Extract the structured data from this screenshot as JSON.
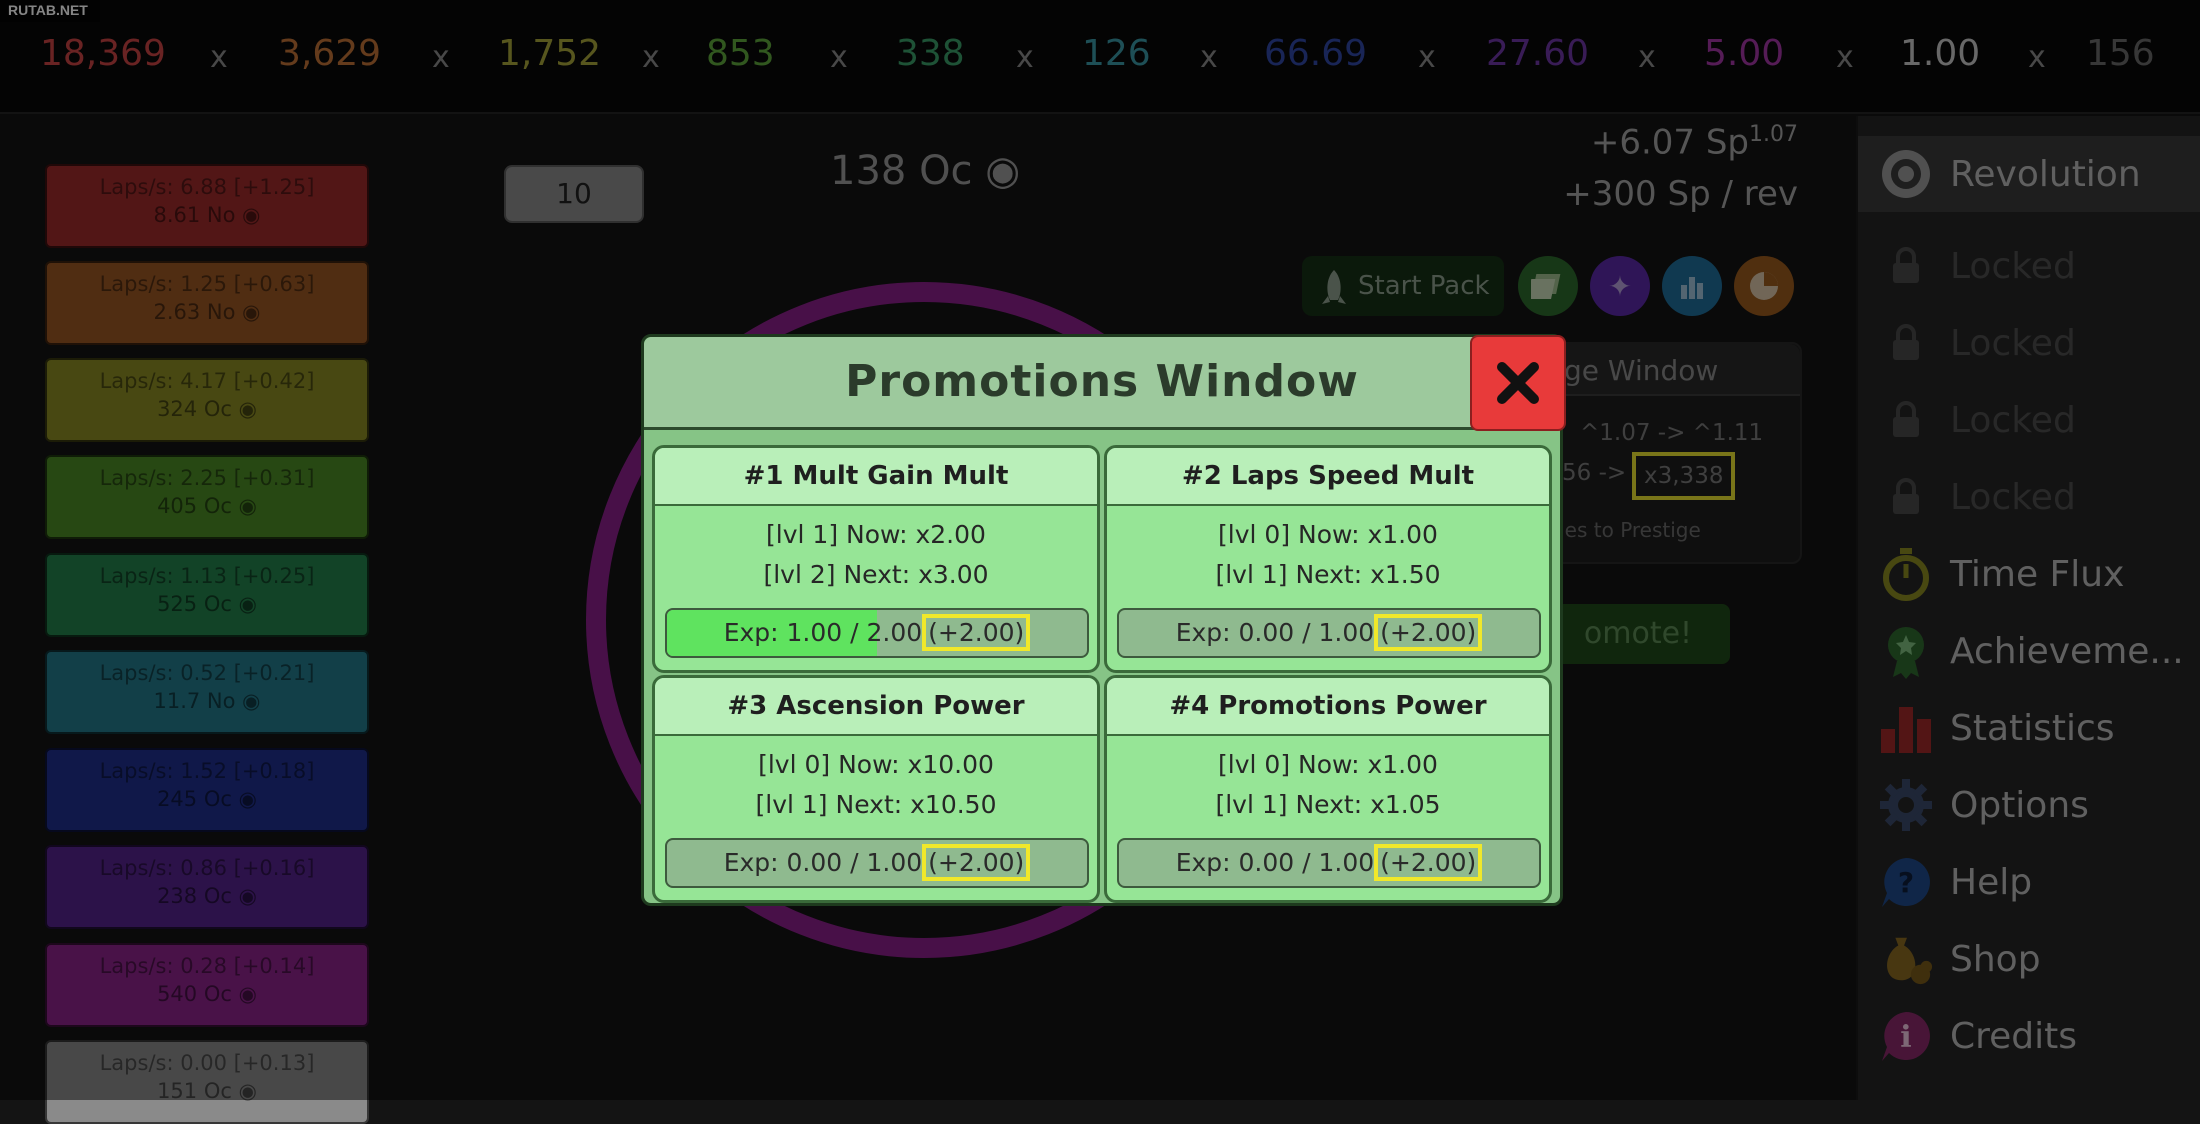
{
  "watermark": "RUTAB.NET",
  "multipliers": [
    {
      "value": "18,369",
      "color": "#c94343"
    },
    {
      "value": "3,629",
      "color": "#c07236"
    },
    {
      "value": "1,752",
      "color": "#a8a63a"
    },
    {
      "value": "853",
      "color": "#5ea83c"
    },
    {
      "value": "338",
      "color": "#3a9e68"
    },
    {
      "value": "126",
      "color": "#3a98a6"
    },
    {
      "value": "66.69",
      "color": "#3048a6"
    },
    {
      "value": "27.60",
      "color": "#6e36a6"
    },
    {
      "value": "5.00",
      "color": "#a336a6"
    },
    {
      "value": "1.00",
      "color": "#c7c7c7"
    },
    {
      "value": "156",
      "color": "#6a6a6a"
    }
  ],
  "multiplier_separator": "x",
  "rings": [
    {
      "line1": "Laps/s: 6.88 [+1.25]",
      "line2": "8.61 No",
      "color": "#9e2b2b"
    },
    {
      "line1": "Laps/s: 1.25 [+0.63]",
      "line2": "2.63 No",
      "color": "#9a5624"
    },
    {
      "line1": "Laps/s: 4.17 [+0.42]",
      "line2": "324 Oc",
      "color": "#8b8a24"
    },
    {
      "line1": "Laps/s: 2.25 [+0.31]",
      "line2": "405 Oc",
      "color": "#4c8a25"
    },
    {
      "line1": "Laps/s: 1.13 [+0.25]",
      "line2": "525 Oc",
      "color": "#23804b"
    },
    {
      "line1": "Laps/s: 0.52 [+0.21]",
      "line2": "11.7 No",
      "color": "#23798a"
    },
    {
      "line1": "Laps/s: 1.52 [+0.18]",
      "line2": "245 Oc",
      "color": "#1f2f8c"
    },
    {
      "line1": "Laps/s: 0.86 [+0.16]",
      "line2": "238 Oc",
      "color": "#55238c"
    },
    {
      "line1": "Laps/s: 0.28 [+0.14]",
      "line2": "540 Oc",
      "color": "#8c238a"
    },
    {
      "line1": "Laps/s: 0.00 [+0.13]",
      "line2": "151 Oc",
      "color": "#8a8a8a"
    }
  ],
  "quantity_input": "10",
  "orbit_count": "138 Oc",
  "sp_rate": "+6.07 Sp",
  "sp_exponent": "1.07",
  "sp_per_rev": "+300 Sp / rev",
  "buttons": {
    "start_pack": "Start Pack"
  },
  "prestige_card": {
    "title": "ge Window",
    "exp_line": "^1.07 -> ^1.11",
    "mult_prefix": "56 ->",
    "mult_value": "x3,338",
    "footer": "nes to Prestige"
  },
  "promote_label": "omote!",
  "sidebar": [
    {
      "label": "Revolution",
      "icon": "target-icon",
      "active": true
    },
    {
      "label": "Locked",
      "icon": "lock-icon"
    },
    {
      "label": "Locked",
      "icon": "lock-icon"
    },
    {
      "label": "Locked",
      "icon": "lock-icon"
    },
    {
      "label": "Locked",
      "icon": "lock-icon"
    },
    {
      "label": "Time Flux",
      "icon": "stopwatch-icon"
    },
    {
      "label": "Achieveme...",
      "icon": "medal-icon"
    },
    {
      "label": "Statistics",
      "icon": "bar-chart-icon"
    },
    {
      "label": "Options",
      "icon": "gear-icon"
    },
    {
      "label": "Help",
      "icon": "help-icon"
    },
    {
      "label": "Shop",
      "icon": "money-bag-icon"
    },
    {
      "label": "Credits",
      "icon": "info-icon"
    }
  ],
  "modal": {
    "title": "Promotions Window",
    "cards": [
      {
        "title": "#1 Mult Gain Mult",
        "now": "[lvl 1] Now: x2.00",
        "next": "[lvl 2] Next: x3.00",
        "exp": "Exp: 1.00 / 2.00",
        "gain": "(+2.00)",
        "progress": 0.5
      },
      {
        "title": "#2 Laps Speed Mult",
        "now": "[lvl 0] Now: x1.00",
        "next": "[lvl 1] Next: x1.50",
        "exp": "Exp: 0.00 / 1.00",
        "gain": "(+2.00)",
        "progress": 0
      },
      {
        "title": "#3 Ascension Power",
        "now": "[lvl 0] Now: x10.00",
        "next": "[lvl 1] Next: x10.50",
        "exp": "Exp: 0.00 / 1.00",
        "gain": "(+2.00)",
        "progress": 0
      },
      {
        "title": "#4 Promotions Power",
        "now": "[lvl 0] Now: x1.00",
        "next": "[lvl 1] Next: x1.05",
        "exp": "Exp: 0.00 / 1.00",
        "gain": "(+2.00)",
        "progress": 0
      }
    ]
  }
}
